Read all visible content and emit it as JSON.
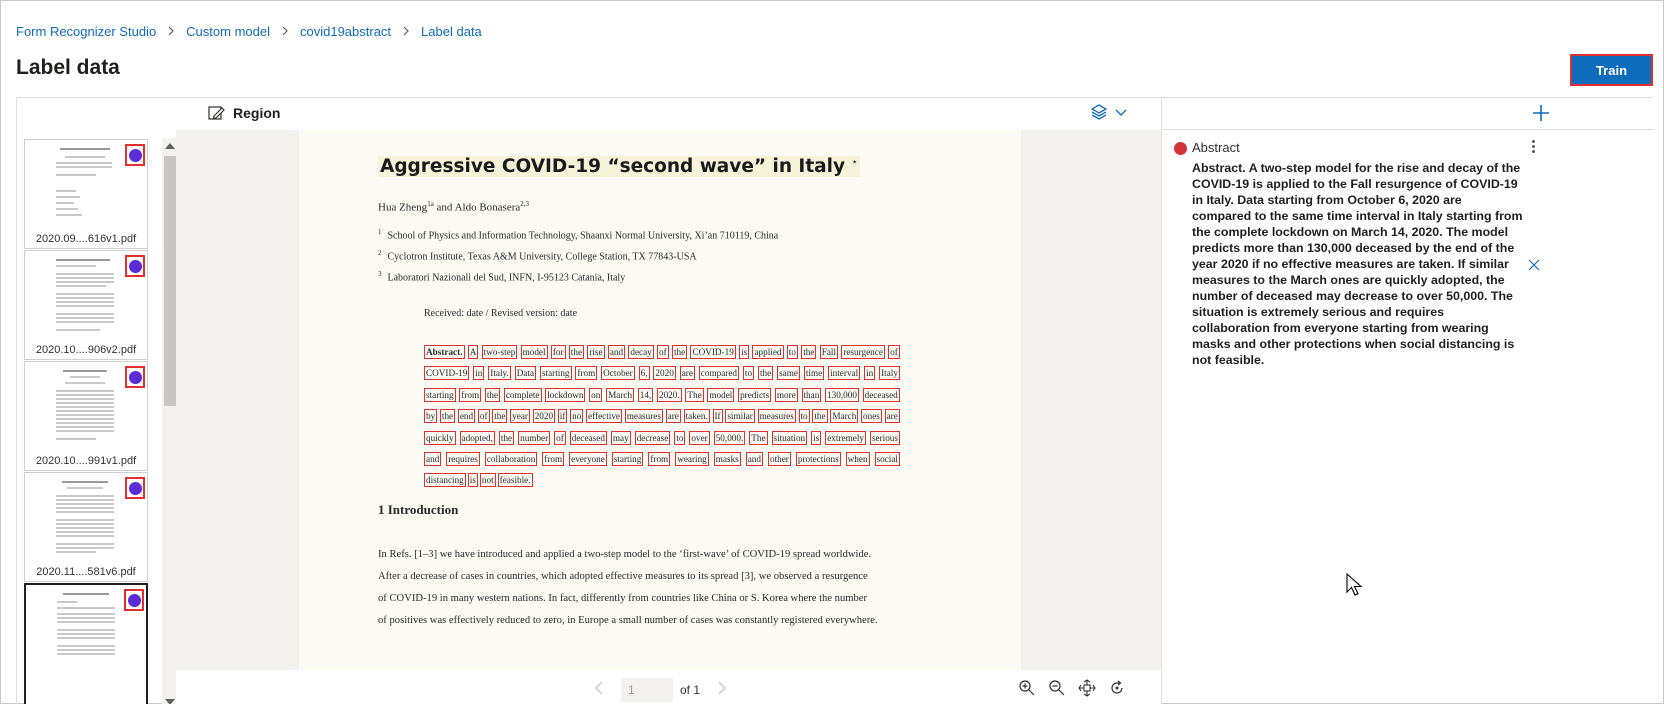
{
  "breadcrumb": [
    "Form Recognizer Studio",
    "Custom model",
    "covid19abstract",
    "Label data"
  ],
  "page_title": "Label data",
  "train_label": "Train",
  "thumbnails": [
    {
      "name": "2020.09....616v1.pdf"
    },
    {
      "name": "2020.10....906v2.pdf"
    },
    {
      "name": "2020.10....991v1.pdf"
    },
    {
      "name": "2020.11....581v6.pdf"
    },
    {
      "name": ""
    }
  ],
  "viewer": {
    "region_label": "Region",
    "page_input_value": "1",
    "page_of": "of 1"
  },
  "document": {
    "title": "Aggressive COVID-19 “second wave” in Italy",
    "title_mark": "⋆",
    "authors": "Hua Zheng",
    "authors_sup1": "1a",
    "authors_and": " and Aldo Bonasera",
    "authors_sup2": "2,3",
    "affiliations": [
      {
        "num": "1",
        "text": "School of Physics and Information Technology, Shaanxi Normal University, Xi’an 710119, China"
      },
      {
        "num": "2",
        "text": "Cyclotron Institute, Texas A&M University, College Station, TX 77843-USA"
      },
      {
        "num": "3",
        "text": "Laboratori Nazionali del Sud, INFN, I-95123 Catania, Italy"
      }
    ],
    "received": "Received: date / Revised version: date",
    "abstract_lines": [
      "Abstract. A two-step model for the rise and decay of the COVID-19 is applied to the Fall resurgence of",
      "COVID-19 in Italy. Data starting from October 6, 2020 are compared to the same time interval in Italy",
      "starting from the complete lockdown on March 14, 2020. The model predicts more than 130,000 deceased",
      "by the end of the year 2020 if no effective measures are taken. If similar measures to the March ones are",
      "quickly adopted, the number of deceased may decrease to over 50,000. The situation is extremely serious",
      "and requires collaboration from everyone starting from wearing masks and other protections when social",
      "distancing is not feasible."
    ],
    "section_title": "1 Introduction",
    "body_lines": [
      "In Refs. [1–3] we have introduced and applied a two-step model to the ‘first-wave’ of COVID-19 spread worldwide.",
      "After a decrease of cases in countries, which adopted effective measures to its spread [3], we observed a resurgence",
      "of COVID-19 in many western nations. In fact, differently from countries like China or S. Korea where the number",
      "of positives was effectively reduced to zero, in Europe a small number of cases was constantly registered everywhere."
    ]
  },
  "field": {
    "name": "Abstract",
    "color": "#d13438",
    "value": "Abstract. A two-step model for the rise and decay of the COVID-19 is applied to the Fall resurgence of COVID-19 in Italy. Data starting from October 6, 2020 are compared to the same time interval in Italy starting from the complete lockdown on March 14, 2020. The model predicts more than 130,000 deceased by the end of the year 2020 if no effective measures are taken. If similar measures to the March ones are quickly adopted, the number of deceased may decrease to over 50,000. The situation is extremely serious and requires collaboration from everyone starting from wearing masks and other protections when social distancing is not feasible."
  },
  "colors": {
    "accent": "#0f6cbd",
    "label_box": "#e03030",
    "label_dot": "#5b2bd6"
  },
  "icons": {
    "region": "region-pencil-icon",
    "layers": "layers-icon",
    "add": "add-icon",
    "more": "more-vertical-icon",
    "clear": "close-icon",
    "zoom_in": "zoom-in-icon",
    "zoom_out": "zoom-out-icon",
    "fit": "fit-page-icon",
    "rotate": "rotate-icon"
  }
}
